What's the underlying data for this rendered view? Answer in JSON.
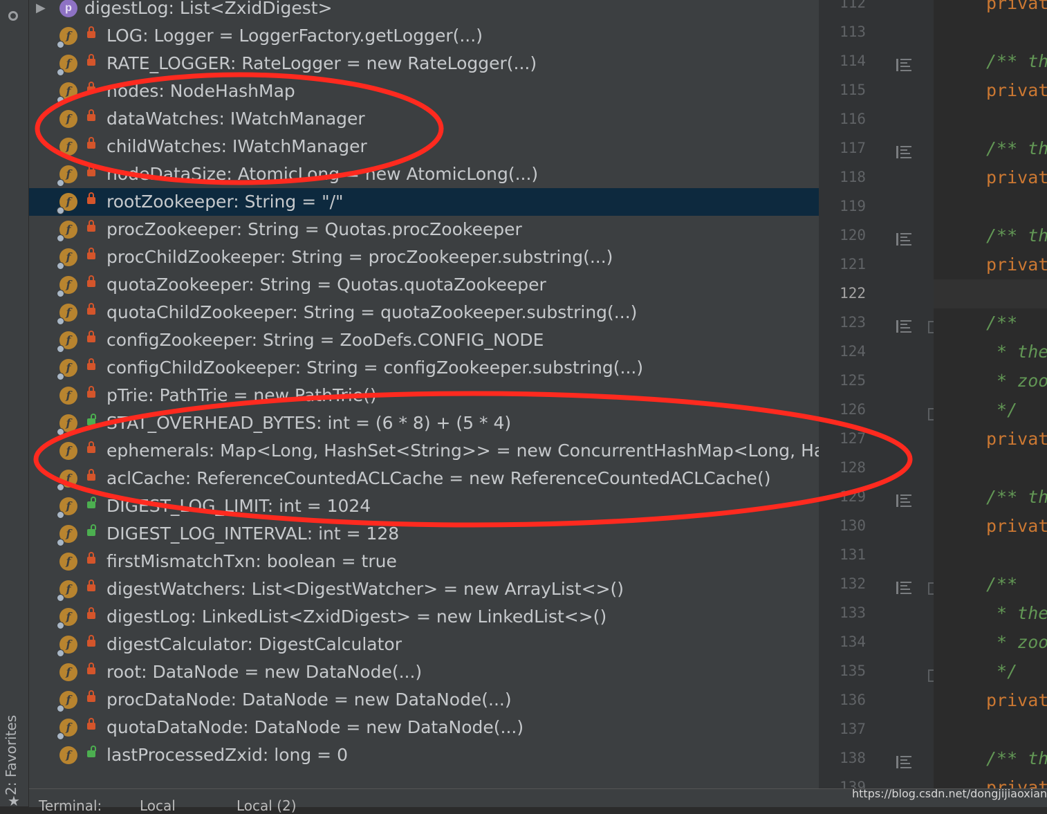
{
  "structure": {
    "header_row": {
      "badge": "p",
      "text": "digestLog: List<ZxidDigest>"
    },
    "rows": [
      {
        "text": "LOG: Logger = LoggerFactory.getLogger(...)",
        "access": "private",
        "static": true
      },
      {
        "text": "RATE_LOGGER: RateLogger = new RateLogger(...)",
        "access": "private",
        "static": true
      },
      {
        "text": "nodes: NodeHashMap",
        "access": "private",
        "static": true
      },
      {
        "text": "dataWatches: IWatchManager",
        "access": "private",
        "static": false
      },
      {
        "text": "childWatches: IWatchManager",
        "access": "private",
        "static": false
      },
      {
        "text": "nodeDataSize: AtomicLong = new AtomicLong(...)",
        "access": "private",
        "static": true
      },
      {
        "text": "rootZookeeper: String = \"/\"",
        "access": "private",
        "static": true,
        "selected": true
      },
      {
        "text": "procZookeeper: String = Quotas.procZookeeper",
        "access": "private",
        "static": true
      },
      {
        "text": "procChildZookeeper: String = procZookeeper.substring(...)",
        "access": "private",
        "static": true
      },
      {
        "text": "quotaZookeeper: String = Quotas.quotaZookeeper",
        "access": "private",
        "static": true
      },
      {
        "text": "quotaChildZookeeper: String = quotaZookeeper.substring(...)",
        "access": "private",
        "static": true
      },
      {
        "text": "configZookeeper: String = ZooDefs.CONFIG_NODE",
        "access": "private",
        "static": true
      },
      {
        "text": "configChildZookeeper: String = configZookeeper.substring(...)",
        "access": "private",
        "static": true
      },
      {
        "text": "pTrie: PathTrie = new PathTrie()",
        "access": "private",
        "static": false
      },
      {
        "text": "STAT_OVERHEAD_BYTES: int = (6 * 8) + (5 * 4)",
        "access": "public",
        "static": true
      },
      {
        "text": "ephemerals: Map<Long, HashSet<String>> = new ConcurrentHashMap<Long, Hash",
        "access": "private",
        "static": false
      },
      {
        "text": "aclCache: ReferenceCountedACLCache = new ReferenceCountedACLCache()",
        "access": "private",
        "static": true
      },
      {
        "text": "DIGEST_LOG_LIMIT: int = 1024",
        "access": "public",
        "static": true
      },
      {
        "text": "DIGEST_LOG_INTERVAL: int = 128",
        "access": "public",
        "static": true
      },
      {
        "text": "firstMismatchTxn: boolean = true",
        "access": "private",
        "static": false
      },
      {
        "text": "digestWatchers: List<DigestWatcher> = new ArrayList<>()",
        "access": "private",
        "static": true
      },
      {
        "text": "digestLog: LinkedList<ZxidDigest> = new LinkedList<>()",
        "access": "private",
        "static": true
      },
      {
        "text": "digestCalculator: DigestCalculator",
        "access": "private",
        "static": true
      },
      {
        "text": "root: DataNode = new DataNode(...)",
        "access": "private",
        "static": false
      },
      {
        "text": "procDataNode: DataNode = new DataNode(...)",
        "access": "private",
        "static": true
      },
      {
        "text": "quotaDataNode: DataNode = new DataNode(...)",
        "access": "private",
        "static": true
      },
      {
        "text": "lastProcessedZxid: long = 0",
        "access": "public",
        "static": false
      }
    ]
  },
  "gutter": {
    "line_numbers": [
      "112",
      "113",
      "114",
      "115",
      "116",
      "117",
      "118",
      "119",
      "120",
      "121",
      "122",
      "123",
      "124",
      "125",
      "126",
      "127",
      "128",
      "129",
      "130",
      "131",
      "132",
      "133",
      "134",
      "135",
      "136",
      "137",
      "138",
      "139"
    ],
    "current_line": "122"
  },
  "editor": {
    "lines": [
      {
        "text": "privat",
        "style": "kw"
      },
      {
        "text": "",
        "style": "kw"
      },
      {
        "text": "/** th",
        "style": "doc"
      },
      {
        "text": "privat",
        "style": "kw"
      },
      {
        "text": "",
        "style": "kw"
      },
      {
        "text": "/** th",
        "style": "doc"
      },
      {
        "text": "privat",
        "style": "kw"
      },
      {
        "text": "",
        "style": "kw"
      },
      {
        "text": "/** th",
        "style": "doc"
      },
      {
        "text": "privat",
        "style": "kw"
      },
      {
        "text": "",
        "style": "kw"
      },
      {
        "text": "/**",
        "style": "doc"
      },
      {
        "text": " * the",
        "style": "doc"
      },
      {
        "text": " * zoo",
        "style": "doc"
      },
      {
        "text": " */",
        "style": "doc"
      },
      {
        "text": "privat",
        "style": "kw"
      },
      {
        "text": "",
        "style": "kw"
      },
      {
        "text": "/** th",
        "style": "doc"
      },
      {
        "text": "privat",
        "style": "kw"
      },
      {
        "text": "",
        "style": "kw"
      },
      {
        "text": "/**",
        "style": "doc"
      },
      {
        "text": " * the",
        "style": "doc"
      },
      {
        "text": " * zoo",
        "style": "doc"
      },
      {
        "text": " */",
        "style": "doc"
      },
      {
        "text": "privat",
        "style": "kw"
      },
      {
        "text": "",
        "style": "kw"
      },
      {
        "text": "/** th",
        "style": "doc"
      },
      {
        "text": "privat",
        "style": "kw"
      }
    ]
  },
  "tool_strip": {
    "favorites_label": "2: Favorites"
  },
  "bottom_bar": {
    "terminal_label": "Terminal:",
    "tab1": "Local",
    "tab2": "Local (2)"
  },
  "watermark": "https://blog.csdn.net/dongjijiaoxiangqu",
  "colors": {
    "annotation": "#ff2a1f",
    "selection": "#0d293e",
    "field_badge": "#b8842f"
  }
}
